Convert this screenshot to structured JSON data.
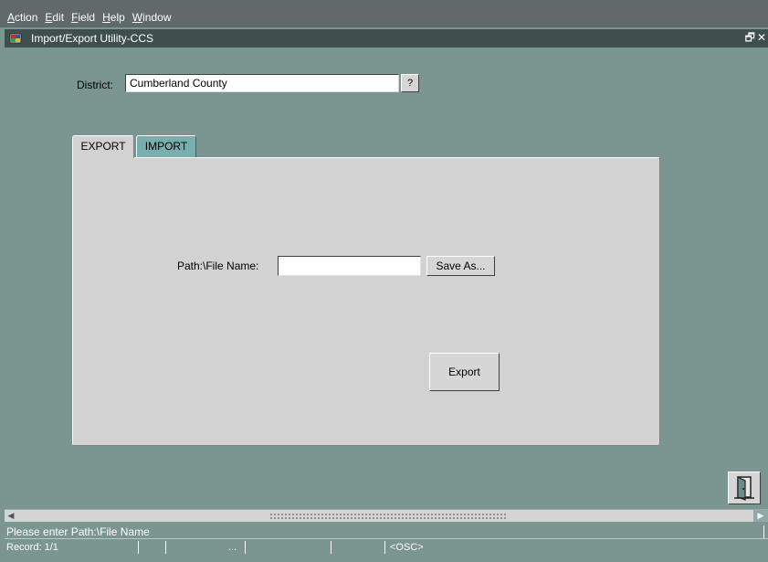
{
  "menu": [
    {
      "mnemonic": "A",
      "rest": "ction"
    },
    {
      "mnemonic": "E",
      "rest": "dit"
    },
    {
      "mnemonic": "F",
      "rest": "ield"
    },
    {
      "mnemonic": "H",
      "rest": "elp"
    },
    {
      "mnemonic": "W",
      "rest": "indow"
    }
  ],
  "window": {
    "title": "Import/Export Utility-CCS",
    "restore_glyph": "🗗",
    "close_glyph": "✕"
  },
  "form": {
    "district_label": "District:",
    "district_value": "Cumberland County",
    "lov_label": "?"
  },
  "tabs": [
    {
      "label": "EXPORT",
      "active": true
    },
    {
      "label": "IMPORT",
      "active": false
    }
  ],
  "export_panel": {
    "path_label": "Path:\\File Name:",
    "path_value": "",
    "save_as_label": "Save As...",
    "export_label": "Export"
  },
  "message_line": "Please enter Path:\\File Name",
  "status": {
    "record": "Record: 1/1",
    "list_indicator": "...",
    "mode": "<OSC>"
  },
  "icons": {
    "app": "forms-app-icon",
    "exit": "exit-door-icon"
  },
  "colors": {
    "background": "#7b9590",
    "titlebar": "#3f4f4e",
    "menubar": "#5f6a69",
    "panel": "#d2d2d2",
    "inactive_tab": "#78aeae"
  }
}
